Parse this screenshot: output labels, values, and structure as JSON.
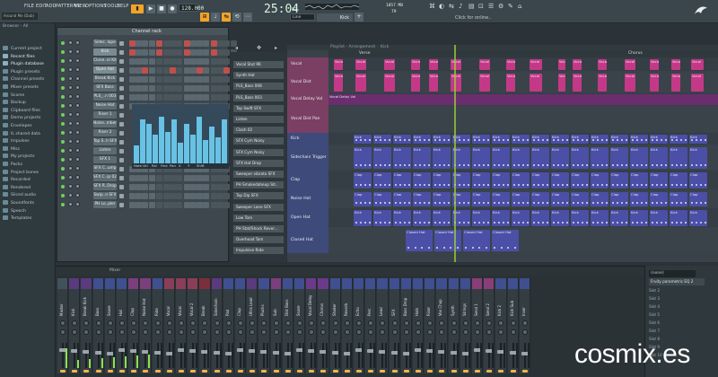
{
  "menu": [
    "FILE",
    "EDIT",
    "ADD",
    "PATTERNS",
    "VIEW",
    "OPTIONS",
    "TOOLS",
    "HELP"
  ],
  "transport": {
    "bpm": "128.000",
    "time": "25:04",
    "time_sub": "02",
    "pattern": "Kick",
    "snap": "Line",
    "hint": "Click for online..",
    "numbers": [
      "1857 MB",
      "79"
    ]
  },
  "browser": {
    "title": "Browser - All",
    "items": [
      "Current project",
      "Recent files",
      "Plugin database",
      "Plugin presets",
      "Channel presets",
      "Mixer presets",
      "Scores",
      "Backup",
      "Clipboard files",
      "Demo projects",
      "Envelopes",
      "IL shared data",
      "Impulses",
      "Misc",
      "My projects",
      "Packs",
      "Project bones",
      "Recorded",
      "Rendered",
      "Sliced audio",
      "Soundfonts",
      "Speech",
      "Templates"
    ]
  },
  "song": "Around Me (Dub)",
  "channel_rack": {
    "title": "Channel rack",
    "channels": [
      "Sidec..lope",
      "Kick",
      "Clone..el Kit",
      "Open Hat",
      "Break Kick",
      "SFX Bass",
      "PLS_..n 003",
      "Noise Hat",
      "Riser 1",
      "Noise..mber",
      "Riser 2",
      "Top S..h SFX",
      "Listen",
      "SFX 1",
      "SFX C..ump",
      "SFX C..ip 02",
      "SFX R..Drop",
      "Swip..n SFX",
      "PH Lo..pler"
    ],
    "steps_active": [
      [
        0,
        4,
        8,
        12
      ],
      [
        0,
        4,
        8,
        12
      ],
      [],
      [
        2,
        6,
        10,
        14
      ],
      [],
      [],
      [],
      [],
      [],
      [],
      [],
      [],
      [],
      [],
      [],
      [],
      [],
      [],
      []
    ],
    "pr_bars": [
      0.35,
      0.85,
      0.75,
      0.55,
      0.9,
      0.6,
      0.85,
      0.4,
      0.75,
      0.55,
      0.9,
      0.45,
      0.7,
      0.5,
      0.85
    ],
    "pr_labels": [
      "Note",
      "Vel",
      "Rel",
      "Fine",
      "Pan",
      "X",
      "Y",
      "Shift"
    ]
  },
  "picker": [
    "Vocal Stut 96",
    "Synth Hat",
    "PLS_Bass 008",
    "PLS_Bass 003",
    "Top Swift SFX",
    "Listen",
    "Clash 02",
    "SFX Cym Noisy",
    "SFX Cym Noisy",
    "SFX Hat Drop",
    "Sweeper vibrato SFX",
    "PH Smokedaheup Str..",
    "Top Dip SFX",
    "Sweeper Lane SFX",
    "Low Tom",
    "PH Stat/Shock Rever...",
    "Overhead Tom",
    "Impulsive Ride"
  ],
  "arrangement": {
    "title": "Playlist - Arrangement",
    "subtitle": "Kick",
    "markers": [
      "Verse",
      "Chorus"
    ],
    "tracks": [
      "Vocal",
      "Vocal Dist",
      "Vocal Delay Vol",
      "Vocal Dist Pan",
      "Kick",
      "Sidechain Trigger",
      "Clap",
      "Noise Hat",
      "Open Hat",
      "Closed Hat"
    ],
    "clip_labels": {
      "vocal": "Vocal",
      "kick": "Kick",
      "clap": "Clap",
      "closed": "Closed Hat",
      "delay": "Vocal Delay Vol"
    }
  },
  "mixer": {
    "title": "Mixer",
    "channels": [
      "Master",
      "Kick",
      "Break Kick",
      "Bass",
      "Snare",
      "Hat",
      "Clap",
      "Noise Hat",
      "Ride",
      "Vocal",
      "Vocal",
      "Vocal 2",
      "Break",
      "Sidechain",
      "Pad",
      "Clap",
      "Ultra Lead",
      "Plucks",
      "Sub",
      "Dist Bass",
      "Snare",
      "Vocal Delay",
      "Chorus",
      "Shaker",
      "Reverb",
      "Echo",
      "Perc",
      "Lead",
      "SFX",
      "Bass Drop",
      "Hats",
      "Riser",
      "Vox Chop",
      "Synth",
      "Strings",
      "Send 1",
      "Send 2",
      "Kick 2",
      "Kick Sub",
      "Inser"
    ],
    "inspector": {
      "name": "(none)",
      "preset": "Fruity parametric EQ 2",
      "slots": [
        "Slot 2",
        "Slot 3",
        "Slot 4",
        "Slot 5",
        "Slot 6",
        "Slot 7",
        "Slot 8",
        "Slot 9",
        "Slot 10"
      ]
    }
  },
  "watermark": "cosmix.es",
  "colors": {
    "accent": "#f2a428",
    "step_red": "#c0504d",
    "step_grey": "#5b686f",
    "pr_bar": "#67c2e4",
    "clip_pink": "#c43987",
    "clip_blue": "#4b4fa6",
    "clip_purple": "#6a2e6f",
    "vu": "#8ee24f"
  }
}
